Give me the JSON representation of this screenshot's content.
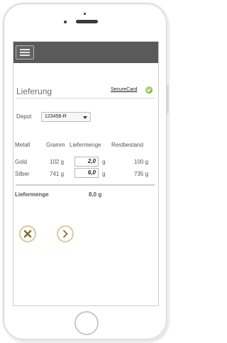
{
  "header": {
    "menu_icon": "hamburger-icon"
  },
  "page": {
    "title": "Lieferung",
    "securecard_label": "SecureCard",
    "securecard_icon": "check-circle-icon"
  },
  "depot": {
    "label": "Depot",
    "selected": "123456-R"
  },
  "table": {
    "columns": [
      "Metall",
      "Gramm",
      "Liefermenge",
      "Restbestand"
    ],
    "rows": [
      {
        "metal": "Gold",
        "gramm": "102 g",
        "liefermenge": "2,0",
        "unit": "g",
        "restbestand": "100 g"
      },
      {
        "metal": "Silber",
        "gramm": "741 g",
        "liefermenge": "6,0",
        "unit": "g",
        "restbestand": "735 g"
      }
    ]
  },
  "total": {
    "label": "Liefermenge",
    "value": "8,0 g"
  },
  "actions": {
    "cancel_icon": "cancel-icon",
    "next_icon": "next-icon"
  },
  "colors": {
    "topbar": "#5a5a5a",
    "button_ring": "#d9c99a",
    "icon_brown": "#8a6a2e",
    "badge_green": "#6aa62a"
  }
}
